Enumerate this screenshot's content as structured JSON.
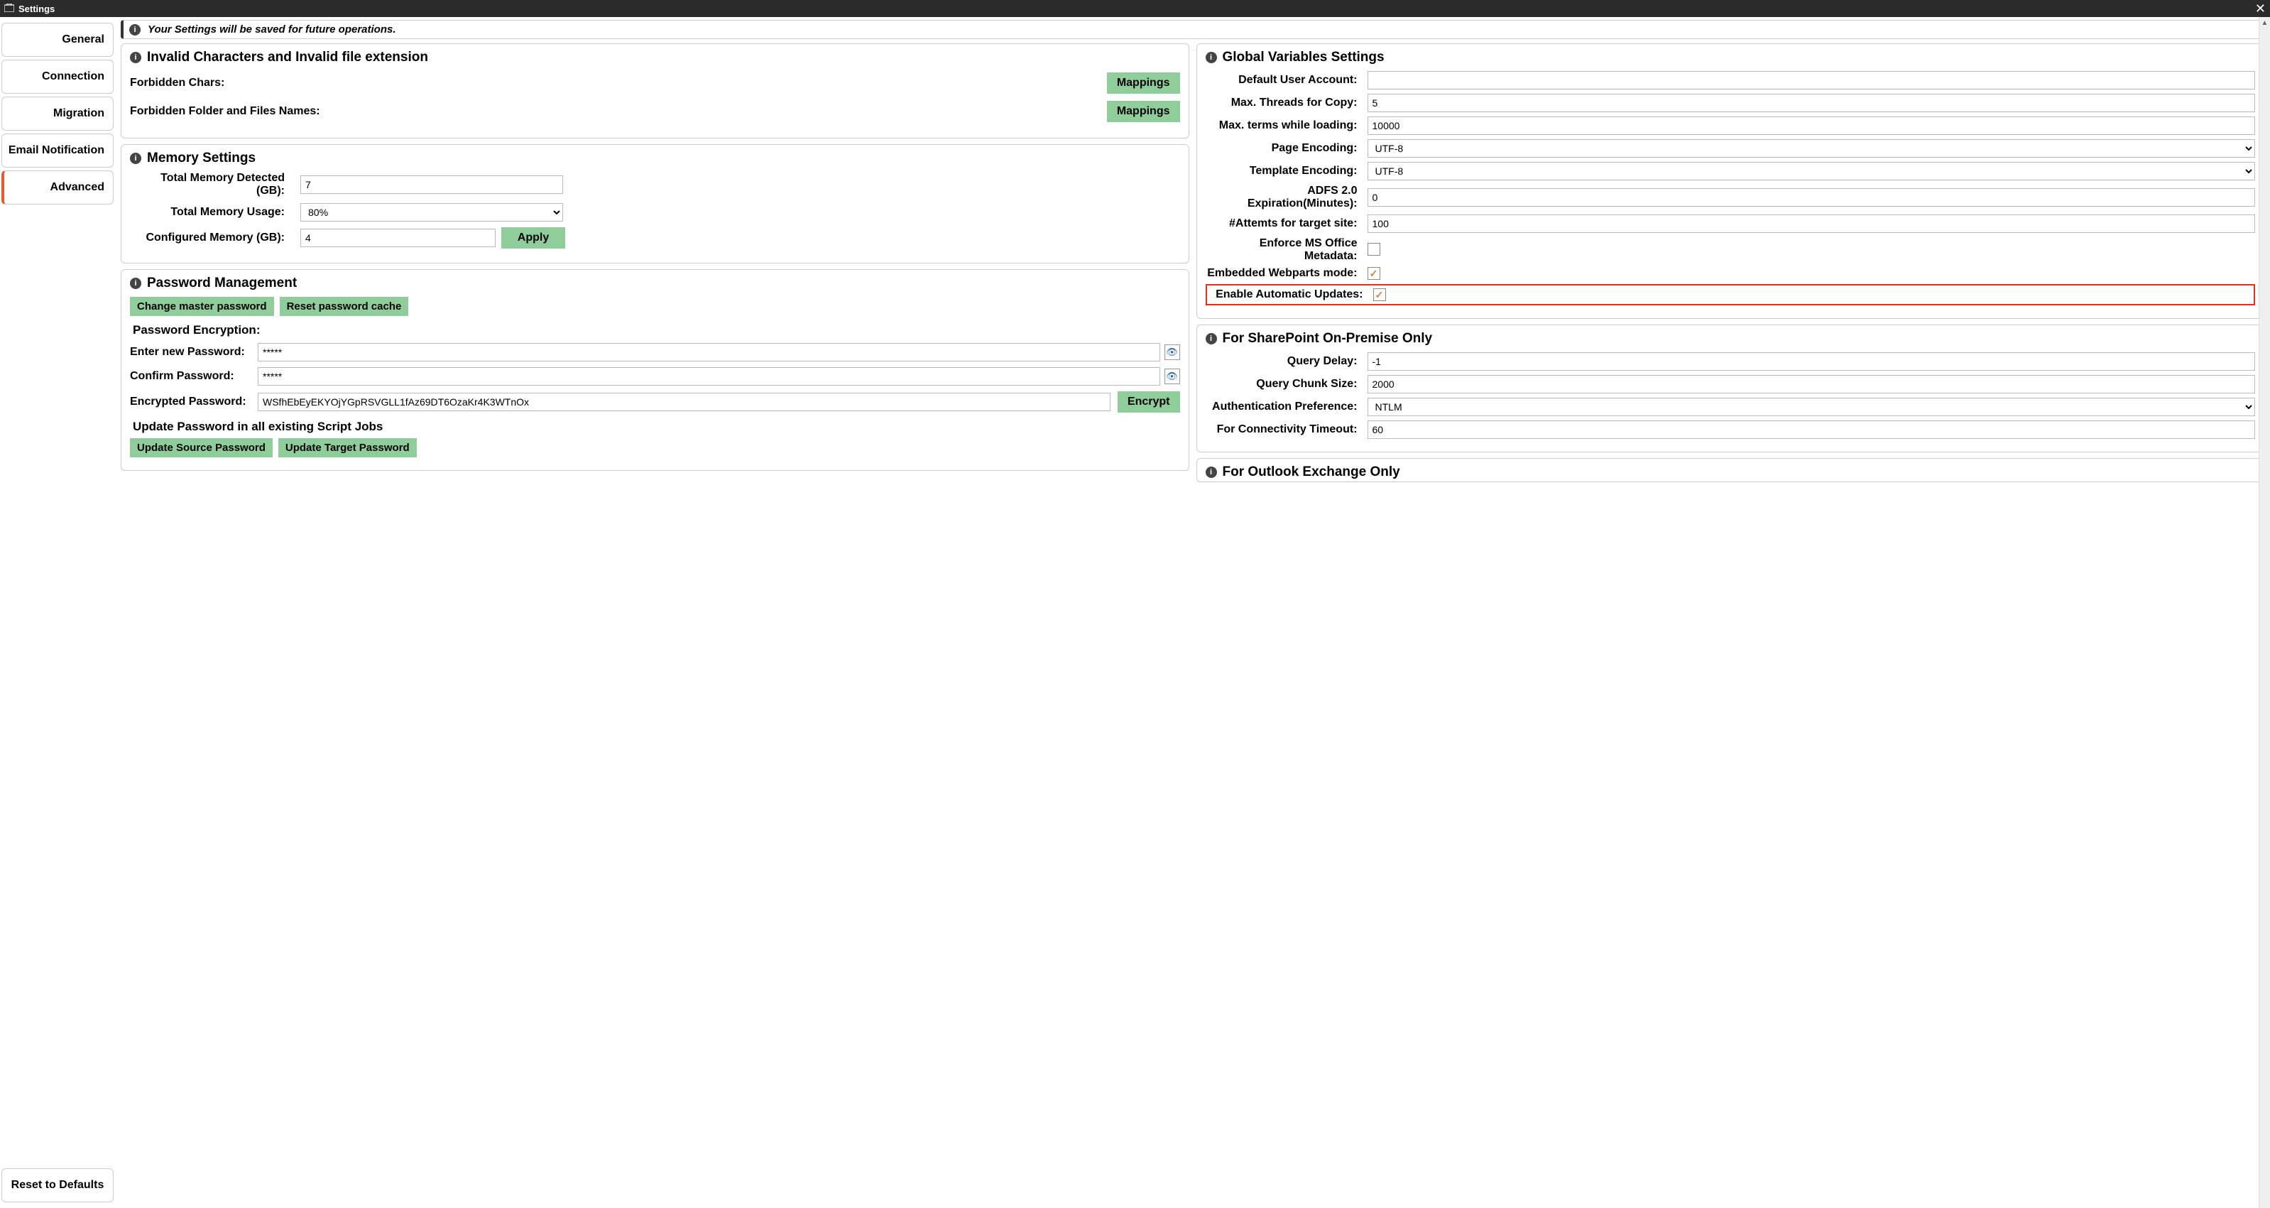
{
  "window": {
    "title": "Settings"
  },
  "banner": {
    "message": "Your Settings will be saved for future operations."
  },
  "sidebar": {
    "tabs": [
      {
        "label": "General"
      },
      {
        "label": "Connection"
      },
      {
        "label": "Migration"
      },
      {
        "label": "Email Notification"
      },
      {
        "label": "Advanced"
      }
    ],
    "reset": "Reset to Defaults"
  },
  "invalid": {
    "title": "Invalid Characters and Invalid file extension",
    "row1": "Forbidden Chars:",
    "row2": "Forbidden Folder and Files Names:",
    "mappings": "Mappings"
  },
  "memory": {
    "title": "Memory Settings",
    "detected_label": "Total Memory Detected (GB):",
    "detected_value": "7",
    "usage_label": "Total Memory Usage:",
    "usage_value": "80%",
    "configured_label": "Configured Memory (GB):",
    "configured_value": "4",
    "apply": "Apply"
  },
  "password": {
    "title": "Password Management",
    "change_master": "Change master password",
    "reset_cache": "Reset password cache",
    "encryption_heading": "Password Encryption:",
    "enter_label": "Enter new Password:",
    "enter_value": "*****",
    "confirm_label": "Confirm Password:",
    "confirm_value": "*****",
    "encrypted_label": "Encrypted Password:",
    "encrypted_value": "WSfhEbEyEKYOjYGpRSVGLL1fAz69DT6OzaKr4K3WTnOx",
    "encrypt_btn": "Encrypt",
    "update_heading": "Update Password in all existing Script Jobs",
    "update_source": "Update Source Password",
    "update_target": "Update Target Password"
  },
  "globals": {
    "title": "Global Variables Settings",
    "default_user_label": "Default User Account:",
    "default_user_value": "",
    "max_threads_label": "Max. Threads for Copy:",
    "max_threads_value": "5",
    "max_terms_label": "Max. terms while loading:",
    "max_terms_value": "10000",
    "page_encoding_label": "Page Encoding:",
    "page_encoding_value": "UTF-8",
    "template_encoding_label": "Template Encoding:",
    "template_encoding_value": "UTF-8",
    "adfs_label": "ADFS 2.0 Expiration(Minutes):",
    "adfs_value": "0",
    "attempts_label": "#Attemts for target site:",
    "attempts_value": "100",
    "enforce_label": "Enforce MS Office Metadata:",
    "enforce_checked": false,
    "webparts_label": "Embedded Webparts mode:",
    "webparts_checked": true,
    "auto_updates_label": "Enable Automatic Updates:",
    "auto_updates_checked": true
  },
  "sharepoint": {
    "title": "For SharePoint On-Premise Only",
    "query_delay_label": "Query Delay:",
    "query_delay_value": "-1",
    "chunk_label": "Query Chunk Size:",
    "chunk_value": "2000",
    "auth_label": "Authentication Preference:",
    "auth_value": "NTLM",
    "timeout_label": "For Connectivity Timeout:",
    "timeout_value": "60"
  },
  "outlook": {
    "title": "For Outlook Exchange Only"
  }
}
